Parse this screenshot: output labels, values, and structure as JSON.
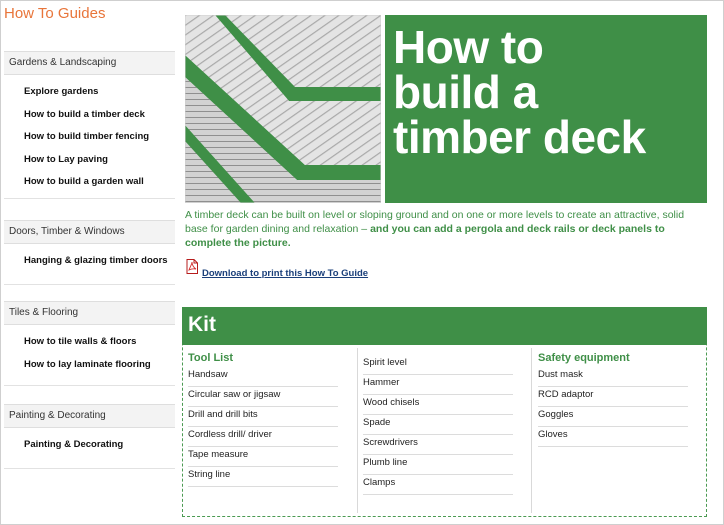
{
  "site": {
    "title": "How To Guides"
  },
  "sidebar": {
    "sections": [
      {
        "title": "Gardens & Landscaping",
        "items": [
          "Explore gardens",
          "How to build a timber deck",
          "How to build timber fencing",
          "How to Lay paving",
          "How to build a garden wall"
        ]
      },
      {
        "title": "Doors, Timber & Windows",
        "items": [
          "Hanging & glazing timber doors"
        ]
      },
      {
        "title": "Tiles & Flooring",
        "items": [
          "How to tile walls & floors",
          "How to lay laminate flooring"
        ]
      },
      {
        "title": "Painting & Decorating",
        "items": [
          "Painting & Decorating"
        ]
      }
    ]
  },
  "hero": {
    "title_line1": "How to",
    "title_line2": "build a",
    "title_line3": "timber deck"
  },
  "intro": {
    "plain": "A timber deck can be built on level or sloping ground and on one or more levels to create an attractive, solid base for garden dining and relaxation – ",
    "bold": "and you can add a pergola and deck rails or deck panels to complete the picture."
  },
  "download": {
    "label": "Download to print this How To Guide"
  },
  "kit": {
    "title": "Kit",
    "tool_list": {
      "heading": "Tool List",
      "col1": [
        "Handsaw",
        "Circular saw or jigsaw",
        "Drill and drill bits",
        "Cordless drill/ driver",
        "Tape measure",
        "String line"
      ],
      "col2": [
        "Spirit level",
        "Hammer",
        "Wood chisels",
        "Spade",
        "Screwdrivers",
        "Plumb line",
        "Clamps"
      ]
    },
    "safety": {
      "heading": "Safety equipment",
      "items": [
        "Dust mask",
        "RCD adaptor",
        "Goggles",
        "Gloves"
      ]
    }
  },
  "colors": {
    "brand_green": "#3f8f47",
    "orange": "#e8753a",
    "link_blue": "#1a3f7a"
  },
  "icons": {
    "download": "pdf-icon"
  }
}
